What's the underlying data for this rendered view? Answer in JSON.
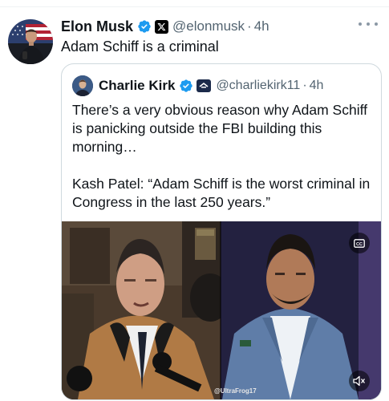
{
  "tweet": {
    "author_name": "Elon Musk",
    "author_handle": "@elonmusk",
    "time": "4h",
    "separator": "·",
    "text": "Adam Schiff is a criminal"
  },
  "quoted_tweet": {
    "author_name": "Charlie Kirk",
    "author_handle": "@charliekirk11",
    "time": "4h",
    "separator": "·",
    "paragraph_1": "There’s a very obvious reason why Adam Schiff is panicking outside the FBI building this morning…",
    "paragraph_2": "Kash Patel: “Adam Schiff is the worst criminal in Congress in the last 250 years.”"
  },
  "media": {
    "watermark": "@UltraFrog17",
    "cc_icon": "closed-captions-icon",
    "mute_icon": "muted-speaker-icon"
  },
  "colors": {
    "verified_blue": "#1d9bf0",
    "secondary_text": "#536471",
    "border": "#cfd9de"
  }
}
